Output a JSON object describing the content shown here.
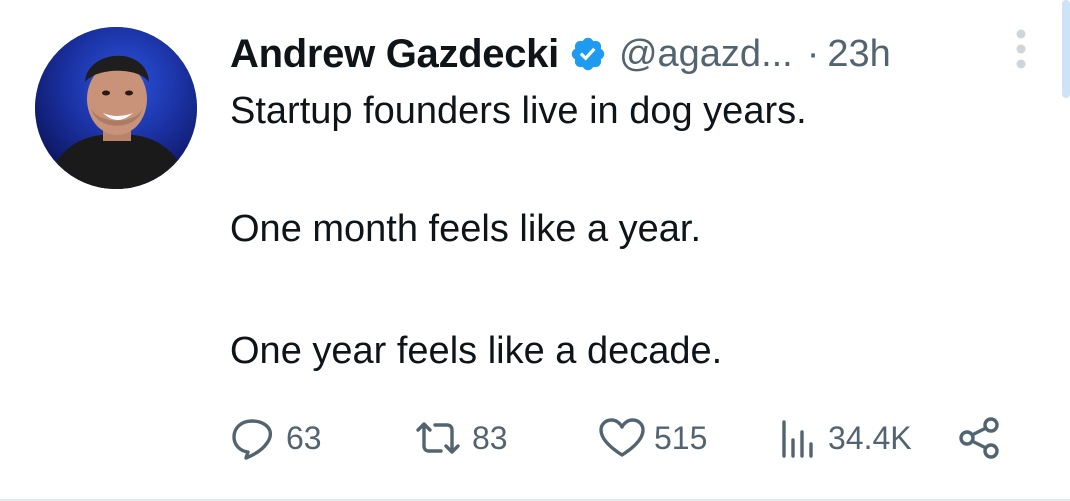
{
  "tweet": {
    "author_name": "Andrew Gazdecki",
    "handle": "@agazd...",
    "separator": "·",
    "time": "23h",
    "lines": [
      "Startup founders live in dog years.",
      "One month feels like a year.",
      "One year feels like a decade."
    ],
    "verified": true,
    "verified_color": "#1d9bf0"
  },
  "actions": {
    "replies": "63",
    "retweets": "83",
    "likes": "515",
    "views": "34.4K"
  },
  "icons": {
    "reply": "reply-bubble-icon",
    "retweet": "retweet-icon",
    "like": "heart-icon",
    "views": "bar-chart-icon",
    "share": "share-icon",
    "more": "more-vertical-icon"
  },
  "colors": {
    "text_primary": "#0f1419",
    "text_secondary": "#536471",
    "accent": "#1d9bf0"
  }
}
